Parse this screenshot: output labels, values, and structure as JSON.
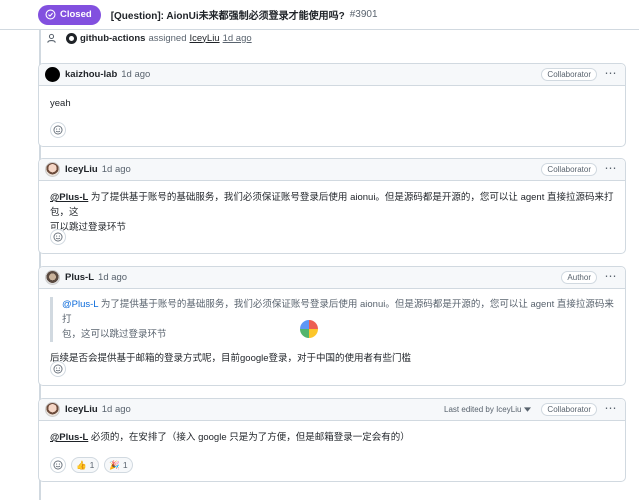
{
  "header": {
    "state": "Closed",
    "title": "[Question]: AionUi未来都强制必须登录才能使用吗?",
    "number": "#3901"
  },
  "event": {
    "actor": "github-actions",
    "action": "assigned",
    "assignee": "IceyLiu",
    "time": "1d ago"
  },
  "comments": [
    {
      "author": "kaizhou-lab",
      "time": "1d ago",
      "role": "Collaborator",
      "body": "yeah"
    },
    {
      "author": "IceyLiu",
      "time": "1d ago",
      "role": "Collaborator",
      "mention": "@Plus-L",
      "body_line1": " 为了提供基于账号的基础服务，我们必须保证账号登录后使用 aionui。但是源码都是开源的，您可以让 agent 直接拉源码来打包，这",
      "body_line2": "可以跳过登录环节"
    },
    {
      "author": "Plus-L",
      "time": "1d ago",
      "role": "Author",
      "quote_mention": "@Plus-L",
      "quote_line1": " 为了提供基于账号的基础服务，我们必须保证账号登录后使用 aionui。但是源码都是开源的，您可以让 agent 直接拉源码来打",
      "quote_line2": "包，这可以跳过登录环节",
      "body": "后续是否会提供基于邮箱的登录方式呢，目前google登录，对于中国的使用者有些门槛"
    },
    {
      "author": "IceyLiu",
      "time": "1d ago",
      "role": "Collaborator",
      "edited": "Last edited by IceyLiu",
      "mention": "@Plus-L",
      "body": " 必须的，在安排了（接入 google 只是为了方便，但是邮箱登录一定会有的）",
      "reactions": [
        {
          "emoji": "👍",
          "count": "1"
        },
        {
          "emoji": "🎉",
          "count": "1"
        }
      ]
    }
  ],
  "icons": {
    "kebab": "⋯"
  }
}
